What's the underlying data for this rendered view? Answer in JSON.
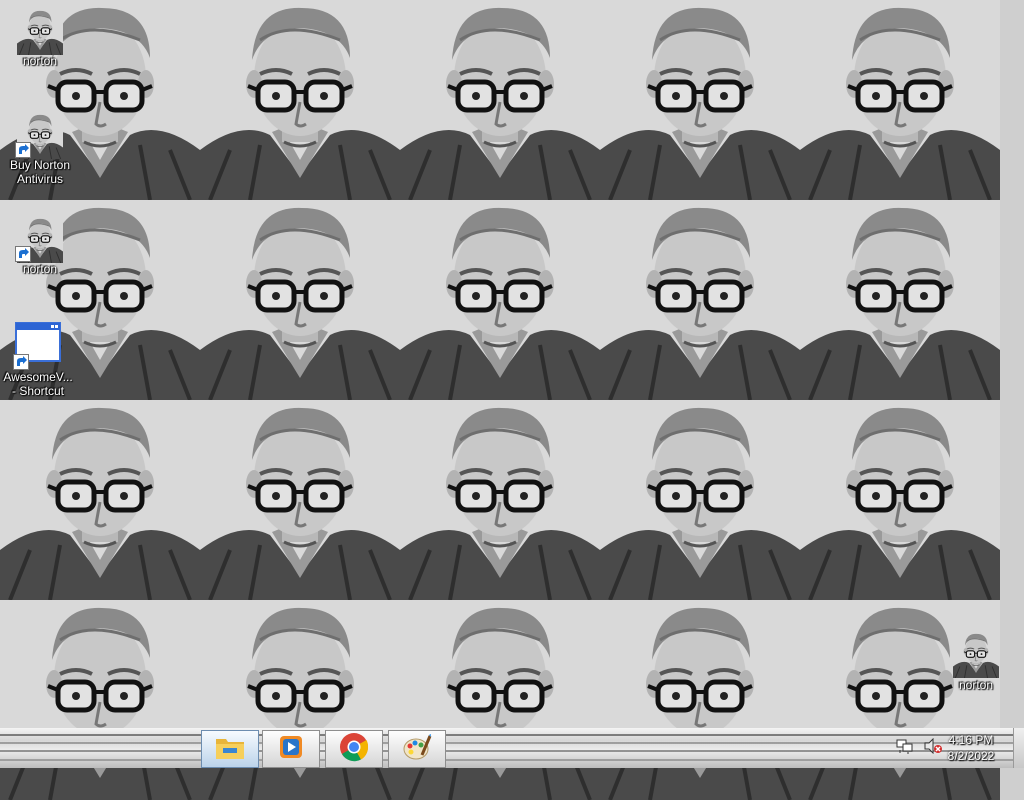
{
  "desktop": {
    "icons": [
      {
        "label": "norton",
        "icon": "portrait-icon",
        "shortcut": false
      },
      {
        "label": "Buy Norton Antivirus",
        "icon": "portrait-icon",
        "shortcut": true
      },
      {
        "label": "norton",
        "icon": "portrait-icon",
        "shortcut": true
      },
      {
        "label": "AwesomeV... - Shortcut",
        "icon": "app-window-icon",
        "shortcut": true
      },
      {
        "label": "norton",
        "icon": "portrait-icon",
        "shortcut": false
      }
    ]
  },
  "taskbar": {
    "apps": [
      {
        "name": "File Explorer",
        "icon": "file-explorer-icon",
        "active": true
      },
      {
        "name": "Media Player",
        "icon": "media-player-icon",
        "active": false
      },
      {
        "name": "Google Chrome",
        "icon": "chrome-icon",
        "active": false
      },
      {
        "name": "Paint",
        "icon": "paint-icon",
        "active": false
      }
    ],
    "tray": {
      "network_icon": "network-icon",
      "volume_icon": "volume-muted-icon"
    },
    "clock": {
      "time": "4:16 PM",
      "date": "8/2/2022"
    }
  },
  "colors": {
    "taskbar_top": "#f4f4f4",
    "taskbar_bottom": "#bdbdbd",
    "label_text": "#ffffff"
  }
}
